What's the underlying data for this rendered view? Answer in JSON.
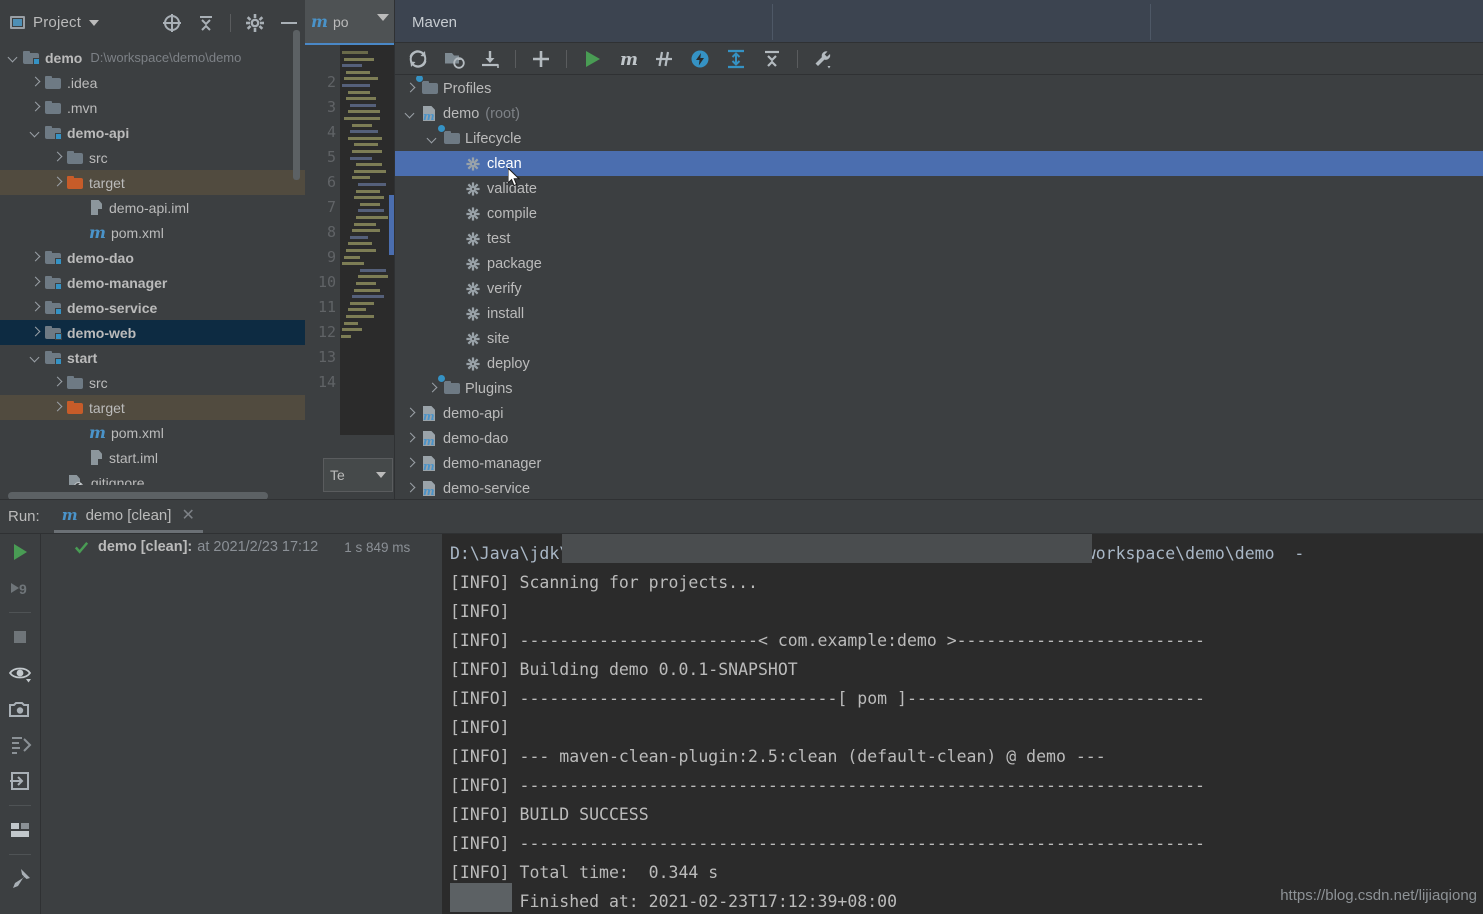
{
  "project": {
    "title": "Project",
    "icons": [
      "project-window-icon",
      "chevron-down-icon",
      "locate-icon",
      "collapse-all-icon",
      "gear-icon",
      "hide-icon"
    ],
    "tree": [
      {
        "label": "demo",
        "path": "D:\\workspace\\demo\\demo",
        "icon": "module-folder-icon",
        "indent": 0,
        "arrow": "down",
        "bold": true,
        "state": "normal"
      },
      {
        "label": ".idea",
        "path": "",
        "icon": "folder-icon",
        "indent": 1,
        "arrow": "right",
        "bold": false,
        "state": "normal"
      },
      {
        "label": ".mvn",
        "path": "",
        "icon": "folder-icon",
        "indent": 1,
        "arrow": "right",
        "bold": false,
        "state": "normal"
      },
      {
        "label": "demo-api",
        "path": "",
        "icon": "module-folder-icon",
        "indent": 1,
        "arrow": "down",
        "bold": true,
        "state": "normal"
      },
      {
        "label": "src",
        "path": "",
        "icon": "folder-icon",
        "indent": 2,
        "arrow": "right",
        "bold": false,
        "state": "normal"
      },
      {
        "label": "target",
        "path": "",
        "icon": "folder-excluded-icon",
        "indent": 2,
        "arrow": "right",
        "bold": false,
        "state": "olive"
      },
      {
        "label": "demo-api.iml",
        "path": "",
        "icon": "iml-file-icon",
        "indent": 3,
        "arrow": "none",
        "bold": false,
        "state": "normal"
      },
      {
        "label": "pom.xml",
        "path": "",
        "icon": "maven-pom-icon",
        "indent": 3,
        "arrow": "none",
        "bold": false,
        "state": "normal"
      },
      {
        "label": "demo-dao",
        "path": "",
        "icon": "module-folder-icon",
        "indent": 1,
        "arrow": "right",
        "bold": true,
        "state": "normal"
      },
      {
        "label": "demo-manager",
        "path": "",
        "icon": "module-folder-icon",
        "indent": 1,
        "arrow": "right",
        "bold": true,
        "state": "normal"
      },
      {
        "label": "demo-service",
        "path": "",
        "icon": "module-folder-icon",
        "indent": 1,
        "arrow": "right",
        "bold": true,
        "state": "normal"
      },
      {
        "label": "demo-web",
        "path": "",
        "icon": "module-folder-icon",
        "indent": 1,
        "arrow": "right",
        "bold": true,
        "state": "selected"
      },
      {
        "label": "start",
        "path": "",
        "icon": "module-folder-icon",
        "indent": 1,
        "arrow": "down",
        "bold": true,
        "state": "normal"
      },
      {
        "label": "src",
        "path": "",
        "icon": "folder-icon",
        "indent": 2,
        "arrow": "right",
        "bold": false,
        "state": "normal"
      },
      {
        "label": "target",
        "path": "",
        "icon": "folder-excluded-icon",
        "indent": 2,
        "arrow": "right",
        "bold": false,
        "state": "olive"
      },
      {
        "label": "pom.xml",
        "path": "",
        "icon": "maven-pom-icon",
        "indent": 3,
        "arrow": "none",
        "bold": false,
        "state": "normal"
      },
      {
        "label": "start.iml",
        "path": "",
        "icon": "iml-file-icon",
        "indent": 3,
        "arrow": "none",
        "bold": false,
        "state": "normal"
      },
      {
        "label": ".gitignore",
        "path": "",
        "icon": "gitignore-file-icon",
        "indent": 2,
        "arrow": "none",
        "bold": false,
        "state": "normal"
      }
    ]
  },
  "editor": {
    "tab_label": "po",
    "tab_icon": "maven-pom-icon",
    "inspection_status": "check-ok",
    "line_numbers": [
      "",
      "2",
      "3",
      "4",
      "5",
      "6",
      "7",
      "8",
      "9",
      "10",
      "11",
      "12",
      "13",
      "14"
    ],
    "bottom_combo": "Te"
  },
  "maven": {
    "title": "Maven",
    "toolbar": [
      "reload-all-icon",
      "generate-sources-icon",
      "download-sources-icon",
      "add-icon",
      "run-icon",
      "execute-maven-goal-icon",
      "toggle-skip-tests-icon",
      "toggle-offline-icon",
      "expand-all-icon",
      "collapse-all-icon",
      "settings-wrench-icon"
    ],
    "tree": [
      {
        "label": "Profiles",
        "suffix": "",
        "indent": 0,
        "arrow": "right",
        "icon": "profiles-folder-icon",
        "state": "normal"
      },
      {
        "label": "demo",
        "suffix": "(root)",
        "indent": 0,
        "arrow": "down",
        "icon": "maven-project-icon",
        "state": "normal"
      },
      {
        "label": "Lifecycle",
        "suffix": "",
        "indent": 1,
        "arrow": "down",
        "icon": "lifecycle-folder-icon",
        "state": "normal"
      },
      {
        "label": "clean",
        "suffix": "",
        "indent": 2,
        "arrow": "none",
        "icon": "goal-gear-icon",
        "state": "selected"
      },
      {
        "label": "validate",
        "suffix": "",
        "indent": 2,
        "arrow": "none",
        "icon": "goal-gear-icon",
        "state": "normal"
      },
      {
        "label": "compile",
        "suffix": "",
        "indent": 2,
        "arrow": "none",
        "icon": "goal-gear-icon",
        "state": "normal"
      },
      {
        "label": "test",
        "suffix": "",
        "indent": 2,
        "arrow": "none",
        "icon": "goal-gear-icon",
        "state": "normal"
      },
      {
        "label": "package",
        "suffix": "",
        "indent": 2,
        "arrow": "none",
        "icon": "goal-gear-icon",
        "state": "normal"
      },
      {
        "label": "verify",
        "suffix": "",
        "indent": 2,
        "arrow": "none",
        "icon": "goal-gear-icon",
        "state": "normal"
      },
      {
        "label": "install",
        "suffix": "",
        "indent": 2,
        "arrow": "none",
        "icon": "goal-gear-icon",
        "state": "normal"
      },
      {
        "label": "site",
        "suffix": "",
        "indent": 2,
        "arrow": "none",
        "icon": "goal-gear-icon",
        "state": "normal"
      },
      {
        "label": "deploy",
        "suffix": "",
        "indent": 2,
        "arrow": "none",
        "icon": "goal-gear-icon",
        "state": "normal"
      },
      {
        "label": "Plugins",
        "suffix": "",
        "indent": 1,
        "arrow": "right",
        "icon": "plugins-folder-icon",
        "state": "normal"
      },
      {
        "label": "demo-api",
        "suffix": "",
        "indent": 0,
        "arrow": "right",
        "icon": "maven-project-icon",
        "state": "normal"
      },
      {
        "label": "demo-dao",
        "suffix": "",
        "indent": 0,
        "arrow": "right",
        "icon": "maven-project-icon",
        "state": "normal"
      },
      {
        "label": "demo-manager",
        "suffix": "",
        "indent": 0,
        "arrow": "right",
        "icon": "maven-project-icon",
        "state": "normal"
      },
      {
        "label": "demo-service",
        "suffix": "",
        "indent": 0,
        "arrow": "right",
        "icon": "maven-project-icon",
        "state": "normal"
      }
    ]
  },
  "run": {
    "label": "Run:",
    "tab_title": "demo [clean]",
    "tab_icon": "maven-pom-icon",
    "close_icon": "close-icon",
    "toolbar": [
      "rerun-icon",
      "rerun-failed-tests-icon",
      "stop-icon",
      "show-passed-icon",
      "export-snapshot-icon",
      "sort-tests-icon",
      "scroll-to-source-icon",
      "layout-icon",
      "pin-tab-icon"
    ],
    "tree_row": {
      "status_icon": "check-ok-icon",
      "name": "demo [clean]:",
      "at": "at 2021/2/23 17:12",
      "duration": "1 s 849 ms"
    },
    "console_lines": [
      "D:\\Java\\jdk\\bin\\java.exe -Dmaven.multiModuleProjectDirectory=D:\\workspace\\demo\\demo  -",
      "[INFO] Scanning for projects...",
      "[INFO] ",
      "[INFO] ------------------------< com.example:demo >-------------------------",
      "[INFO] Building demo 0.0.1-SNAPSHOT",
      "[INFO] --------------------------------[ pom ]------------------------------",
      "[INFO] ",
      "[INFO] --- maven-clean-plugin:2.5:clean (default-clean) @ demo ---",
      "[INFO] ---------------------------------------------------------------------",
      "[INFO] BUILD SUCCESS",
      "[INFO] ---------------------------------------------------------------------",
      "[INFO] Total time:  0.344 s",
      "[INFO] Finished at: 2021-02-23T17:12:39+08:00"
    ],
    "watermark": "https://blog.csdn.net/lijiaqiong"
  },
  "colors": {
    "background": "#3c3f41",
    "console_background": "#2b2b2b",
    "selection_blue": "#4b6eaf",
    "selection_inactive": "#0d2b42",
    "excluded_olive": "#514b3f",
    "header_bar": "#3c4450",
    "accent_green": "#499c54",
    "link_blue": "#4a93c9",
    "folder_orange": "#c75c29"
  }
}
